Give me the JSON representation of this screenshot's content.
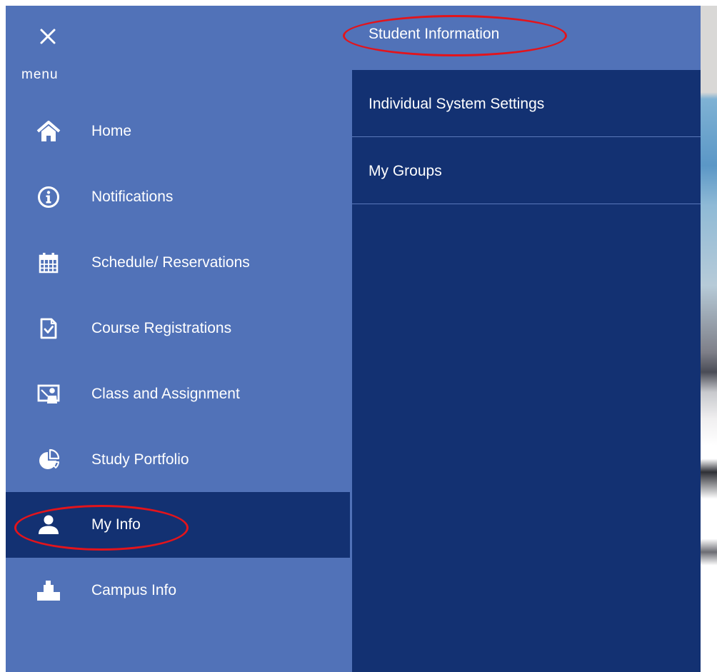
{
  "menu": {
    "close_label": "×",
    "title": "menu",
    "items": [
      {
        "label": "Home",
        "icon": "home-icon"
      },
      {
        "label": "Notifications",
        "icon": "info-icon"
      },
      {
        "label": "Schedule/ Reservations",
        "icon": "calendar-icon"
      },
      {
        "label": "Course Registrations",
        "icon": "checked-document-icon"
      },
      {
        "label": "Class and Assignment",
        "icon": "teacher-board-icon"
      },
      {
        "label": "Study Portfolio",
        "icon": "pie-chart-icon"
      },
      {
        "label": "My Info",
        "icon": "person-icon",
        "active": true
      },
      {
        "label": "Campus Info",
        "icon": "building-icon"
      }
    ]
  },
  "submenu": {
    "title": "Student Information",
    "items": [
      {
        "label": "Individual System Settings"
      },
      {
        "label": "My Groups"
      }
    ]
  },
  "colors": {
    "menu_bg": "#5172b8",
    "active_bg": "#133172",
    "submenu_bg": "#133172",
    "text": "#ffffff",
    "annotation": "#e3141b"
  }
}
